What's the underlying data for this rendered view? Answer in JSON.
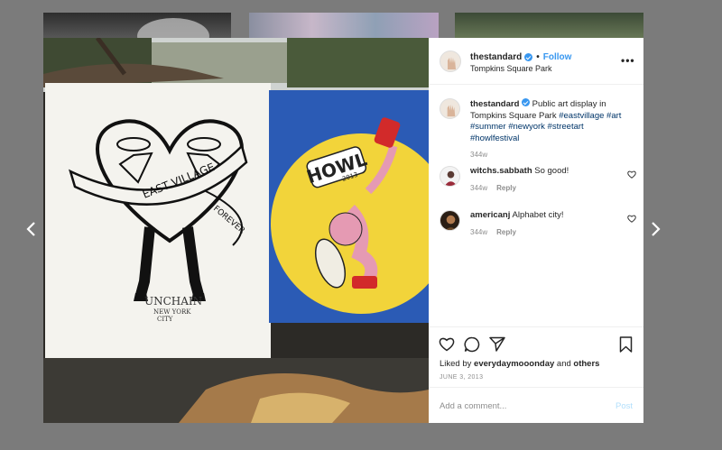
{
  "post": {
    "username": "thestandard",
    "follow_label": "Follow",
    "separator": "•",
    "location": "Tompkins Square Park",
    "more_label": "•••"
  },
  "caption": {
    "username": "thestandard",
    "text": "Public art display in Tompkins Square Park",
    "hashtags": [
      "#eastvillage",
      "#art",
      "#summer",
      "#newyork",
      "#streetart",
      "#howlfestival"
    ],
    "age": "344w"
  },
  "comments": [
    {
      "username": "witchs.sabbath",
      "text": "So good!",
      "age": "344w",
      "reply_label": "Reply"
    },
    {
      "username": "americanj",
      "text": "Alphabet city!",
      "age": "344w",
      "reply_label": "Reply"
    }
  ],
  "likes": {
    "prefix": "Liked by",
    "user": "everydaymooonday",
    "joiner": "and",
    "others": "others"
  },
  "date": "JUNE 3, 2013",
  "add_comment": {
    "placeholder": "Add a comment...",
    "post_label": "Post"
  },
  "artwork_text": {
    "banner": "EAST VILLAGE",
    "right": "FOREVER",
    "bottom1": "UNCHAIN",
    "bottom2": "NEW YORK",
    "bottom3": "CITY",
    "howl": "HOWL",
    "year": "2013"
  },
  "colors": {
    "link": "#3897f0",
    "hashtag": "#003569",
    "muted": "#8e8e8e",
    "mural_blue": "#2b5bb5",
    "mural_yellow": "#f2d43a"
  }
}
